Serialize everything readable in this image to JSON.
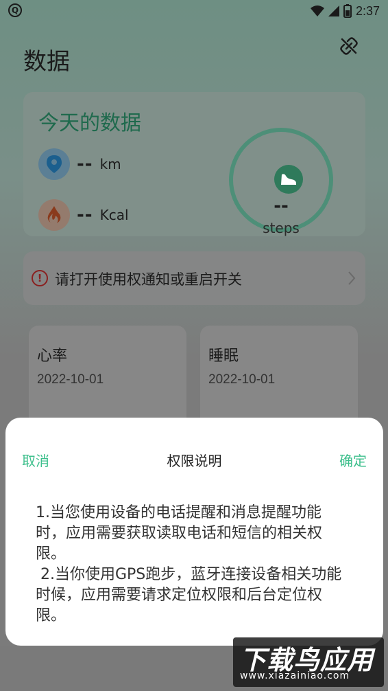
{
  "status_bar": {
    "app_badge": "Q",
    "time": "2:37"
  },
  "header": {
    "title": "数据",
    "link_icon": "link-off-icon"
  },
  "today": {
    "title": "今天的数据",
    "distance": {
      "value": "--",
      "unit": "km",
      "icon": "location-pin-icon"
    },
    "calories": {
      "value": "--",
      "unit": "Kcal",
      "icon": "flame-icon"
    },
    "steps": {
      "value": "--",
      "unit": "steps",
      "icon": "shoe-icon"
    }
  },
  "notice": {
    "text": "请打开使用权通知或重启开关"
  },
  "cards": [
    {
      "title": "心率",
      "date": "2022-10-01"
    },
    {
      "title": "睡眠",
      "date": "2022-10-01"
    }
  ],
  "dialog": {
    "cancel": "取消",
    "title": "权限说明",
    "confirm": "确定",
    "body": "1.当您使用设备的电话提醒和消息提醒功能时，应用需要获取读取电话和短信的相关权限。\n 2.当你使用GPS跑步，蓝牙连接设备相关功能时候，应用需要请求定位权限和后台定位权限。"
  },
  "watermark": {
    "main": "下载鸟应用",
    "sub": "www.xiazainiao.com"
  },
  "colors": {
    "accent": "#3dbf8c",
    "alert": "#8a2020"
  }
}
